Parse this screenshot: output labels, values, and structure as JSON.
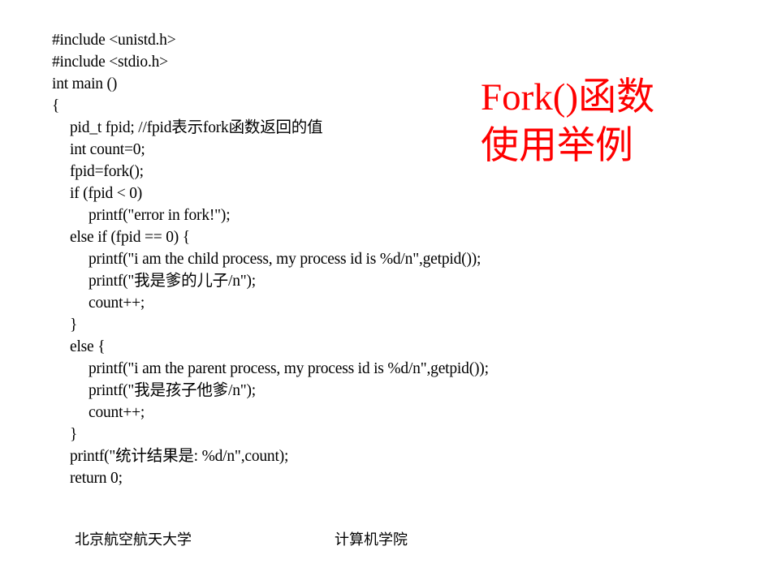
{
  "code": {
    "lines": [
      {
        "indent": 0,
        "text": "#include <unistd.h>"
      },
      {
        "indent": 0,
        "text": "#include <stdio.h>"
      },
      {
        "indent": 0,
        "text": "int main ()"
      },
      {
        "indent": 0,
        "text": "{"
      },
      {
        "indent": 1,
        "text": "pid_t fpid; //fpid表示fork函数返回的值"
      },
      {
        "indent": 1,
        "text": "int count=0;"
      },
      {
        "indent": 1,
        "text": "fpid=fork();"
      },
      {
        "indent": 1,
        "text": "if (fpid < 0)"
      },
      {
        "indent": 2,
        "text": "printf(\"error in fork!\");"
      },
      {
        "indent": 1,
        "text": "else if (fpid == 0) {"
      },
      {
        "indent": 2,
        "text": "printf(\"i am the child process, my process id is %d/n\",getpid());"
      },
      {
        "indent": 2,
        "text": "printf(\"我是爹的儿子/n\");"
      },
      {
        "indent": 2,
        "text": "count++;"
      },
      {
        "indent": 1,
        "text": "}"
      },
      {
        "indent": 1,
        "text": "else {"
      },
      {
        "indent": 2,
        "text": "printf(\"i am the parent process, my process id is %d/n\",getpid());"
      },
      {
        "indent": 2,
        "text": "printf(\"我是孩子他爹/n\");"
      },
      {
        "indent": 2,
        "text": "count++;"
      },
      {
        "indent": 1,
        "text": "}"
      },
      {
        "indent": 1,
        "text": "printf(\"统计结果是: %d/n\",count);"
      },
      {
        "indent": 1,
        "text": "return 0;"
      }
    ]
  },
  "title": {
    "line1": "Fork()函数",
    "line2": "使用举例",
    "color": "#ff0000"
  },
  "footer": {
    "left": "北京航空航天大学",
    "right": "计算机学院"
  }
}
